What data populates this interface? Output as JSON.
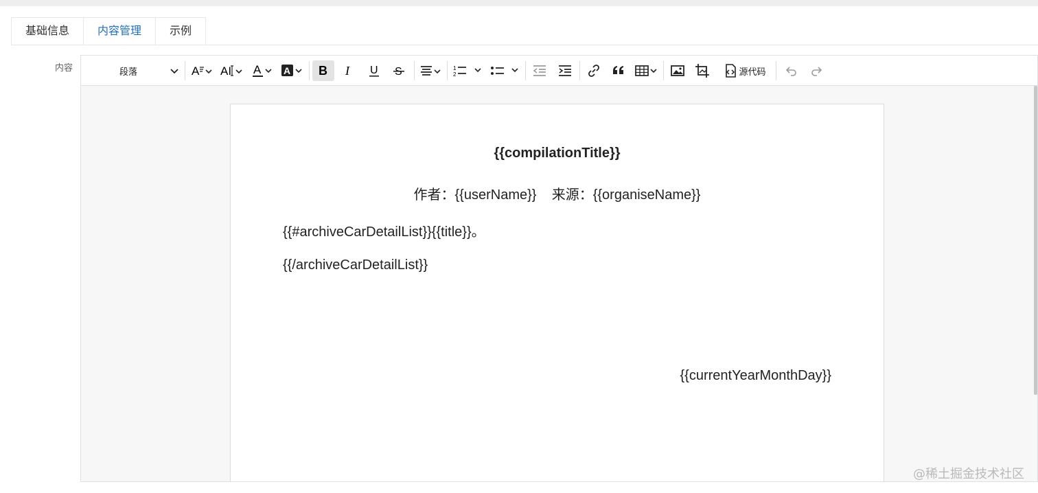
{
  "tabs": [
    {
      "label": "基础信息",
      "active": false
    },
    {
      "label": "内容管理",
      "active": true
    },
    {
      "label": "示例",
      "active": false
    }
  ],
  "form": {
    "content_label": "内容"
  },
  "toolbar": {
    "block_format": "段落",
    "source_code_label": "源代码",
    "icons": [
      "font-size-icon",
      "letter-spacing-icon",
      "font-color-icon",
      "highlight-color-icon",
      "bold-icon",
      "italic-icon",
      "underline-icon",
      "strikethrough-icon",
      "align-icon",
      "ordered-list-icon",
      "bullet-list-icon",
      "outdent-icon",
      "indent-icon",
      "link-icon",
      "blockquote-icon",
      "table-icon",
      "image-icon",
      "crop-image-icon",
      "source-code-icon",
      "undo-icon",
      "redo-icon"
    ]
  },
  "document": {
    "title": "{{compilationTitle}}",
    "author_line": "作者：{{userName}}    来源：{{organiseName}}",
    "loop_start": "{{#archiveCarDetailList}}{{title}}。",
    "loop_end": "{{/archiveCarDetailList}}",
    "date": "{{currentYearMonthDay}}"
  },
  "watermark": "@稀土掘金技术社区",
  "colors": {
    "accent": "#1f6fc5",
    "border": "#dcdfe6"
  }
}
